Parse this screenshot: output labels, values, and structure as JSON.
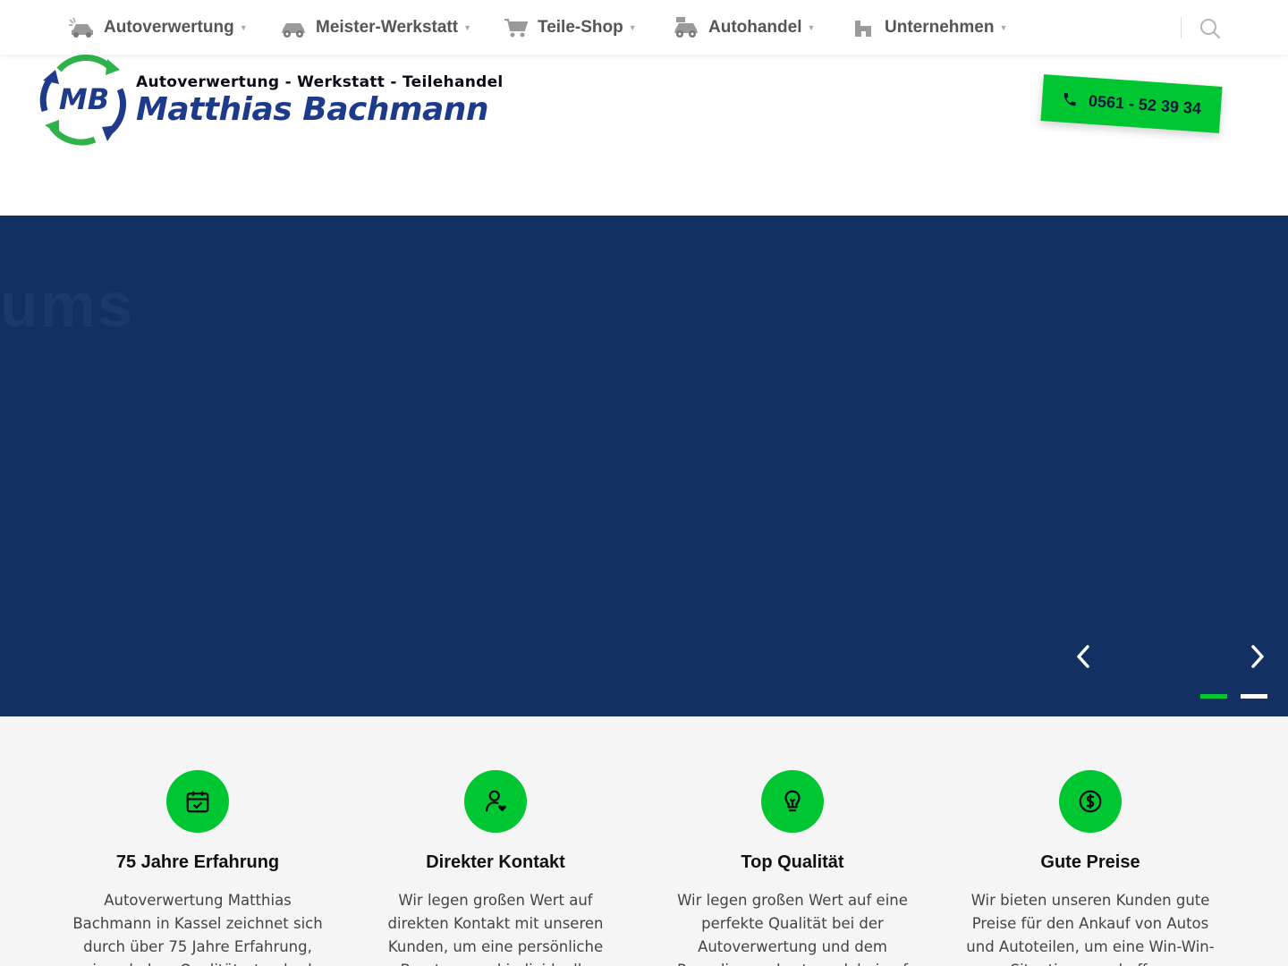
{
  "nav": {
    "items": [
      {
        "label": "Autoverwertung",
        "icon": "car-crash-icon"
      },
      {
        "label": "Meister-Werkstatt",
        "icon": "car-repair-icon"
      },
      {
        "label": "Teile-Shop",
        "icon": "shopping-cart-icon"
      },
      {
        "label": "Autohandel",
        "icon": "car-dealer-icon"
      },
      {
        "label": "Unternehmen",
        "icon": "building-icon"
      }
    ],
    "search_icon": "search-icon"
  },
  "header": {
    "logo_monogram": "MB",
    "logo_tagline": "Autoverwertung - Werkstatt - Teilehandel",
    "logo_name": "Matthias Bachmann",
    "phone": "0561 - 52 39 34"
  },
  "hero": {
    "ghost_text": "ums",
    "background_color": "#123162",
    "slides_total": 2,
    "active_slide": 1
  },
  "features": [
    {
      "icon": "calendar-check-icon",
      "title": "75 Jahre Erfahrung",
      "text": "Autoverwertung Matthias Bachmann in Kassel zeichnet sich durch über 75 Jahre Erfahrung, einen hohen Qualitätsstandard und eine"
    },
    {
      "icon": "user-heart-icon",
      "title": "Direkter Kontakt",
      "text": "Wir legen großen Wert auf direkten Kontakt mit unseren Kunden, um eine persönliche Beratung und individuelle Lösungen für ihre Anfragen bieten"
    },
    {
      "icon": "lightbulb-icon",
      "title": "Top Qualität",
      "text": "Wir legen großen Wert auf eine perfekte Qualität bei der Autoverwertung und dem Recycling und setzen dabei auf modernste"
    },
    {
      "icon": "dollar-circle-icon",
      "title": "Gute Preise",
      "text": "Wir bieten unseren Kunden gute Preise für den Ankauf von Autos und Autoteilen, um eine Win-Win-Situation zu schaffen."
    }
  ],
  "colors": {
    "brand_green": "#00c632",
    "brand_blue": "#1e3a8a",
    "hero_navy": "#123162"
  }
}
